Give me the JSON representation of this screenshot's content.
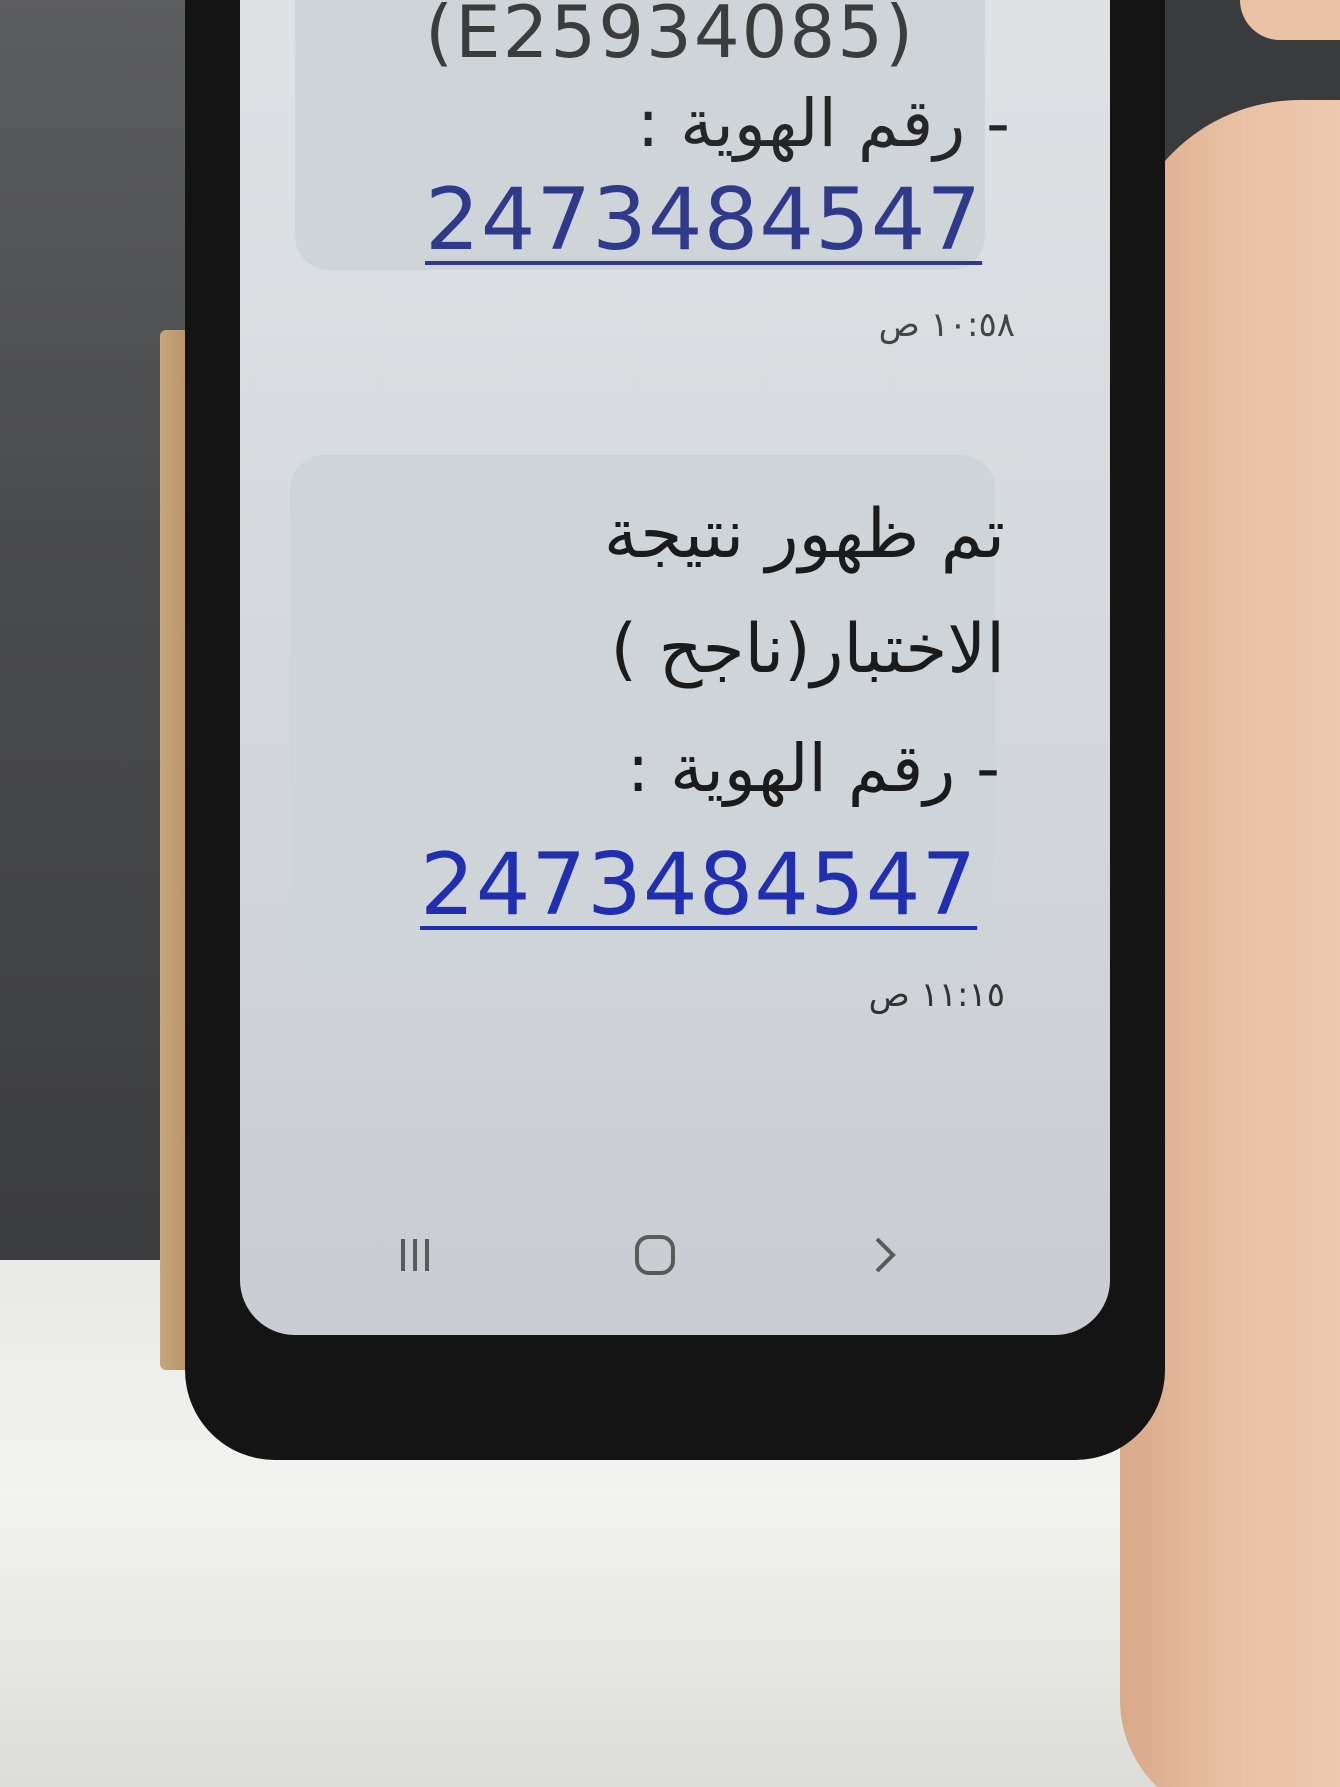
{
  "messages": [
    {
      "code_line": "(E25934085)",
      "id_label": "- رقم الهوية :",
      "id_number": "2473484547",
      "timestamp": "١٠:٥٨ ص"
    },
    {
      "line_1": "تم ظهور نتيجة",
      "line_2": "الاختبار(ناجح )",
      "id_label": "- رقم الهوية :",
      "id_number": "2473484547",
      "timestamp": "١١:١٥ ص"
    }
  ],
  "nav": {
    "recent_icon": "recent-apps-icon",
    "home_icon": "home-icon",
    "back_icon": "back-icon"
  },
  "colors": {
    "link_blue": "#1f2fb0",
    "bubble_bg": "#cfd4d9",
    "screen_bg": "#dfe3e6"
  }
}
